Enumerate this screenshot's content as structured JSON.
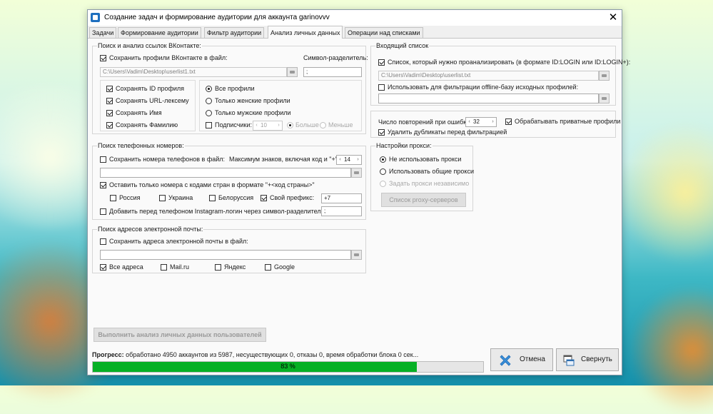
{
  "window": {
    "title": "Создание задач и формирование аудитории для аккаунта garinovvv"
  },
  "tabs": [
    {
      "label": "Задачи"
    },
    {
      "label": "Формирование аудитории"
    },
    {
      "label": "Фильтр аудитории"
    },
    {
      "label": "Анализ личных данных",
      "active": true
    },
    {
      "label": "Операции над списками"
    }
  ],
  "vk_links": {
    "title": "Поиск и анализ ссылок ВКонтакте:",
    "save_profiles_label": "Сохранить профили ВКонтакте в файл:",
    "delimiter_label": "Символ-разделитель:",
    "file_path": "C:\\Users\\Vadim\\Desktop\\userlist1.txt",
    "delimiter_value": ";",
    "fields": [
      {
        "label": "Сохранять ID профиля",
        "checked": true
      },
      {
        "label": "Сохранять URL-лексему",
        "checked": true
      },
      {
        "label": "Сохранять Имя",
        "checked": true
      },
      {
        "label": "Сохранять Фамилию",
        "checked": true
      }
    ],
    "gender": [
      {
        "label": "Все профили",
        "checked": true
      },
      {
        "label": "Только женские профили",
        "checked": false
      },
      {
        "label": "Только мужские профили",
        "checked": false
      }
    ],
    "subscribers_label": "Подписчики:",
    "subscribers_value": "10",
    "more_label": "Больше",
    "less_label": "Меньше"
  },
  "phones": {
    "title": "Поиск телефонных номеров:",
    "save_label": "Сохранить номера телефонов в файл:",
    "max_chars_label": "Максимум знаков, включая код и \"+\":",
    "max_chars_value": "14",
    "file_path": "",
    "country_only_label": "Оставить только номера с кодами стран в формате \"+<код страны>\"",
    "countries": [
      {
        "label": "Россия",
        "checked": false
      },
      {
        "label": "Украина",
        "checked": false
      },
      {
        "label": "Белоруссия",
        "checked": false
      },
      {
        "label": "Свой префикс:",
        "checked": true
      }
    ],
    "prefix_value": "+7",
    "instagram_label": "Добавить перед телефоном Instagram-логин через символ-разделитель:",
    "instagram_delim": ";"
  },
  "emails": {
    "title": "Поиск адресов электронной почты:",
    "save_label": "Сохранить адреса электронной почты в файл:",
    "file_path": "",
    "options": [
      {
        "label": "Все адреса",
        "checked": true
      },
      {
        "label": "Mail.ru",
        "checked": false
      },
      {
        "label": "Яндекс",
        "checked": false
      },
      {
        "label": "Google",
        "checked": false
      }
    ]
  },
  "incoming": {
    "title": "Входящий список",
    "list_label": "Список, который нужно проанализировать (в формате ID:LOGIN или ID:LOGIN+):",
    "list_path": "C:\\Users\\Vadim\\Desktop\\userlist.txt",
    "offline_label": "Использовать для фильтрации offline-базу исходных профилей:",
    "offline_path": ""
  },
  "retries": {
    "label": "Число повторений при ошибке:",
    "value": "32",
    "private_label": "Обрабатывать приватные профили",
    "dedupe_label": "Удалить дубликаты перед фильтрацией"
  },
  "proxy": {
    "title": "Настройки прокси:",
    "options": [
      {
        "label": "Не использовать прокси",
        "checked": true
      },
      {
        "label": "Использовать общие прокси",
        "checked": false
      },
      {
        "label": "Задать прокси независимо",
        "checked": false
      }
    ],
    "servers_button": "Список proxy-серверов"
  },
  "run_button": "Выполнить анализ личных данных пользователей",
  "progress": {
    "label": "Прогресс:",
    "text": "обработано 4950 аккаунтов из 5987, несуществующих 0, отказы 0, время обработки блока 0 сек...",
    "percent": 83,
    "percent_text": "83 %"
  },
  "buttons": {
    "cancel": "Отмена",
    "collapse": "Свернуть"
  },
  "colors": {
    "progress_fill": "#06b025",
    "cancel_icon": "#3a8fd8"
  }
}
